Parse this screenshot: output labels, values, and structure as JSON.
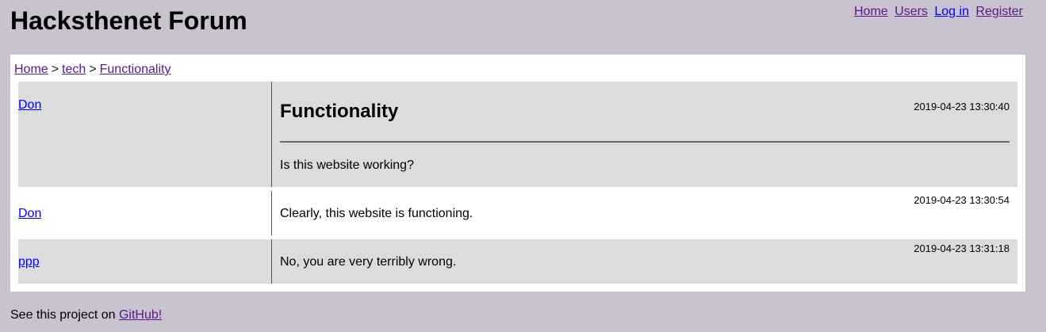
{
  "site": {
    "title": "Hacksthenet Forum"
  },
  "nav": {
    "home": "Home",
    "users": "Users",
    "login": "Log in",
    "register": "Register"
  },
  "breadcrumb": {
    "items": [
      "Home",
      "tech",
      "Functionality"
    ],
    "separator": ">"
  },
  "thread": {
    "title": "Functionality"
  },
  "posts": [
    {
      "author": "Don",
      "timestamp": "2019-04-23 13:30:40",
      "body": "Is this website working?"
    },
    {
      "author": "Don",
      "timestamp": "2019-04-23 13:30:54",
      "body": "Clearly, this website is functioning."
    },
    {
      "author": "ppp",
      "timestamp": "2019-04-23 13:31:18",
      "body": "No, you are very terribly wrong."
    }
  ],
  "footer": {
    "text": "See this project on",
    "link": "GitHub!"
  },
  "colors": {
    "background": "#c9c3cf",
    "panel": "#ffffff",
    "post_shade": "#dcdcdc",
    "visited_link": "#551a8b",
    "link": "#0000ee"
  }
}
